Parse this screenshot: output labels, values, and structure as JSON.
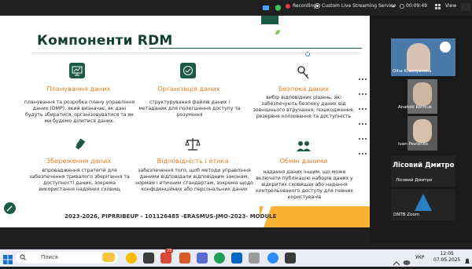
{
  "toolbar": {
    "recording_label": "Recording",
    "stream_label": "Custom Live Streaming Service",
    "timer": "00:09:49",
    "view_label": "View"
  },
  "slide": {
    "title": "Компоненти RDM",
    "cards": [
      {
        "title": "Планування даних",
        "text": "планування та розробка плану управління даних (DMP), який визначає, як дані будуть збиратися, організовуватися та як ми будемо ділитися даних."
      },
      {
        "title": "Організація даних",
        "text": "структурування файлів даних і метаданих для полегшення доступу та розуміння"
      },
      {
        "title": "Безпека даних",
        "text": "вибір відповідних рішень, які забезпечують безпеку даних від зовнішнього втручання, пошкодження, резервне копіювання та доступність"
      },
      {
        "title": "Збереження даних",
        "text": "впровадження стратегій для забезпечення тривалого зберігання та доступності даних, зокрема використання надійних сховищ"
      },
      {
        "title": "Відповідність і етика",
        "text": "забезпечення того, щоб методи управління даними відповідали відповідним законам, нормам і етичним стандартам, зокрема щодо конфіденційних або персональних даних"
      },
      {
        "title": "Обмін даними",
        "text": "надання даних іншим, що може включати публікацію наборів даних у відкритих сховищах або надання контрольованого доступу для певних користувачів"
      }
    ],
    "footer": "2023-2026, PIPRRIBEUP - 101126485 -ERASMUS-JMO-2023- MODULE"
  },
  "participants": {
    "p1": "Olha Krasnyanska",
    "p2": "Anatolii Korniuk",
    "p3": "Ivan Pavlenko",
    "speaker": "Лісовий Дмитро",
    "speaker_small": "Лісовий Дмитро",
    "p5": "DNTB Zoom"
  },
  "taskbar": {
    "search_text": "Поиск",
    "badge": "25",
    "lang": "УКР",
    "time": "12:05",
    "date": "07.05.2025"
  },
  "colors": {
    "title": "#123f2e",
    "accent_orange": "#e2802a",
    "footer_yellow": "#f9b233",
    "icon_green": "#1d5b45"
  }
}
